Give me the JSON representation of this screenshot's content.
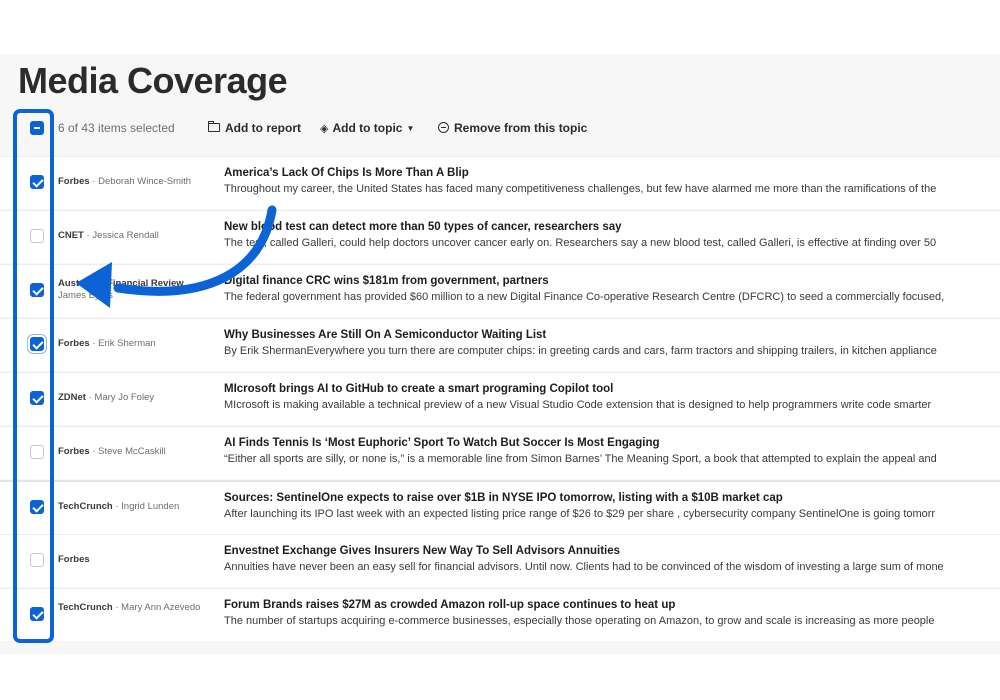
{
  "page": {
    "title": "Media Coverage"
  },
  "toolbar": {
    "selection_text": "6 of 43 items selected",
    "add_to_report": "Add to report",
    "add_to_topic": "Add to topic",
    "remove_from_topic": "Remove from this topic"
  },
  "colors": {
    "accent": "#0b63d6",
    "annotation": "#0b63d6"
  },
  "articles": [
    {
      "source": "Forbes",
      "author": "Deborah Wince-Smith",
      "checked": true,
      "headline": "America’s Lack Of Chips Is More Than A Blip",
      "snippet": "Throughout my career, the United States has faced many competitiveness challenges, but few have alarmed me more than the ramifications of the"
    },
    {
      "source": "CNET",
      "author": "Jessica Rendall",
      "checked": false,
      "headline": "New blood test can detect more than 50 types of cancer, researchers say",
      "snippet": "The test, called Galleri, could help doctors uncover cancer early on. Researchers say a new blood test, called Galleri, is effective at finding over 50"
    },
    {
      "source": "Australian Financial Review",
      "author": "James Eyers",
      "checked": true,
      "headline": "Digital finance CRC wins $181m from government, partners",
      "snippet": "The federal government has provided $60 million to a new Digital Finance Co-operative Research Centre (DFCRC) to seed a commercially focused,"
    },
    {
      "source": "Forbes",
      "author": "Erik Sherman",
      "checked": true,
      "headline": "Why Businesses Are Still On A Semiconductor Waiting List",
      "snippet": "By Erik ShermanEverywhere you turn there are computer chips: in greeting cards and cars, farm tractors and shipping trailers, in kitchen appliance"
    },
    {
      "source": "ZDNet",
      "author": "Mary Jo Foley",
      "checked": true,
      "headline": "MIcrosoft brings AI to GitHub to create a smart programing Copilot tool",
      "snippet": "MIcrosoft is making available a technical preview of a new Visual Studio Code extension that is designed to help programmers write code smarter"
    },
    {
      "source": "Forbes",
      "author": "Steve McCaskill",
      "checked": false,
      "headline": "AI Finds Tennis Is ‘Most Euphoric’ Sport To Watch But Soccer Is Most Engaging",
      "snippet": "“Either all sports are silly, or none is,” is a memorable line from Simon Barnes’ The Meaning Sport, a book that attempted to explain the appeal and"
    },
    {
      "source": "TechCrunch",
      "author": "Ingrid Lunden",
      "checked": true,
      "headline": "Sources: SentinelOne expects to raise over $1B in NYSE IPO tomorrow, listing with a $10B market cap",
      "snippet": "After launching its IPO last week with an expected listing price range of $26 to $29 per share , cybersecurity company SentinelOne is going tomorr"
    },
    {
      "source": "Forbes",
      "author": "",
      "checked": false,
      "headline": "Envestnet Exchange Gives Insurers New Way To Sell Advisors Annuities",
      "snippet": "Annuities have never been an easy sell for financial advisors. Until now. Clients had to be convinced of the wisdom of investing a large sum of mone"
    },
    {
      "source": "TechCrunch",
      "author": "Mary Ann Azevedo",
      "checked": true,
      "headline": "Forum Brands raises $27M as crowded Amazon roll-up space continues to heat up",
      "snippet": "The number of startups acquiring e-commerce businesses, especially those operating on Amazon, to grow and scale is increasing as more people"
    }
  ]
}
